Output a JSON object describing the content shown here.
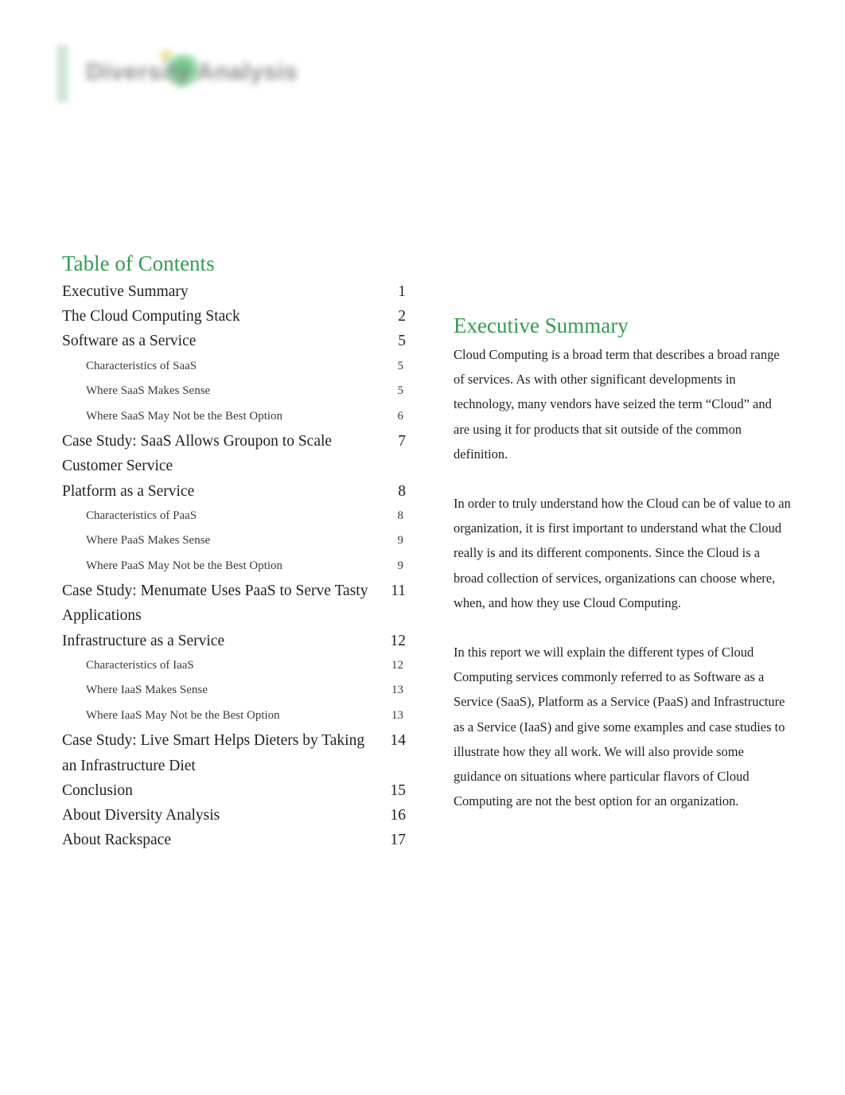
{
  "document": {
    "background_color": "#ffffff",
    "accent_color": "#2ca04c",
    "text_color": "#231f20"
  },
  "logo": {
    "wordmark_primary": "Diversity",
    "wordmark_accent": "Analysis",
    "wordmark_combined": "Diversity Analysis"
  },
  "toc": {
    "title": "Table of Contents",
    "entries": [
      {
        "label": "Executive Summary",
        "page": "1",
        "level": 1
      },
      {
        "label": "The Cloud Computing Stack",
        "page": "2",
        "level": 1
      },
      {
        "label": "Software as a Service",
        "page": "5",
        "level": 1
      },
      {
        "label": "Characteristics of SaaS",
        "page": "5",
        "level": 2
      },
      {
        "label": "Where SaaS Makes Sense",
        "page": "5",
        "level": 2
      },
      {
        "label": "Where SaaS May Not be the Best Option",
        "page": "6",
        "level": 2
      },
      {
        "label": "Case Study: SaaS Allows Groupon to Scale Customer Service",
        "page": "7",
        "level": 1
      },
      {
        "label": "Platform as a Service",
        "page": "8",
        "level": 1
      },
      {
        "label": "Characteristics of PaaS",
        "page": "8",
        "level": 2
      },
      {
        "label": "Where PaaS Makes Sense",
        "page": "9",
        "level": 2
      },
      {
        "label": "Where PaaS May Not be the Best Option",
        "page": "9",
        "level": 2
      },
      {
        "label": "Case Study: Menumate Uses PaaS to Serve Tasty Applications",
        "page": "11",
        "level": 1
      },
      {
        "label": "Infrastructure as a Service",
        "page": "12",
        "level": 1
      },
      {
        "label": "Characteristics of IaaS",
        "page": "12",
        "level": 2
      },
      {
        "label": "Where IaaS Makes Sense",
        "page": "13",
        "level": 2
      },
      {
        "label": "Where IaaS May Not be the Best Option",
        "page": "13",
        "level": 2
      },
      {
        "label": "Case Study: Live Smart Helps Dieters by Taking an Infrastructure Diet",
        "page": "14",
        "level": 1
      },
      {
        "label": "Conclusion",
        "page": "15",
        "level": 1
      },
      {
        "label": "About Diversity Analysis",
        "page": "16",
        "level": 1
      },
      {
        "label": "About Rackspace",
        "page": "17",
        "level": 1
      }
    ]
  },
  "executive_summary": {
    "title": "Executive Summary",
    "paragraphs": [
      "Cloud Computing is a broad term that describes a broad range of services. As with other significant developments in technology, many vendors have seized the term “Cloud” and are using it for products that sit outside of the common definition.",
      "In order to truly understand how the Cloud can be of value to an organization, it is first important to understand what the Cloud really is and its different components. Since the Cloud is a broad collection of services, organizations can choose where, when, and how they use Cloud Computing.",
      "In this report we will explain the different types of Cloud Computing services commonly referred to as Software as a Service (SaaS), Platform as a Service (PaaS) and Infrastructure as a Service (IaaS) and give some examples and case studies to illustrate how they all work. We will also provide some guidance on situations where particular flavors of Cloud Computing are not the best option for an organization."
    ]
  }
}
